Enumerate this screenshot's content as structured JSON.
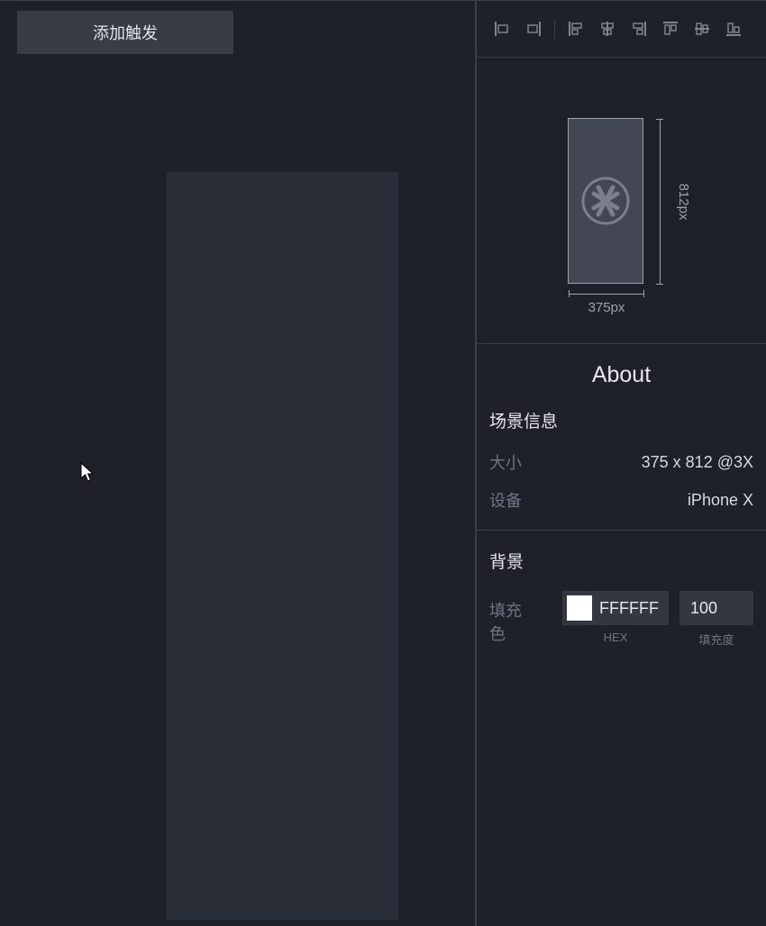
{
  "left": {
    "tab_label": "添加触发"
  },
  "preview": {
    "width_label": "375px",
    "height_label": "812px"
  },
  "about": {
    "title": "About",
    "scene_info_header": "场景信息",
    "size_label": "大小",
    "size_value": "375 x 812 @3X",
    "device_label": "设备",
    "device_value": "iPhone X"
  },
  "background": {
    "header": "背景",
    "fill_label": "填充色",
    "hex_value": "FFFFFF",
    "hex_caption": "HEX",
    "opacity_value": "100",
    "opacity_caption": "填充度"
  }
}
